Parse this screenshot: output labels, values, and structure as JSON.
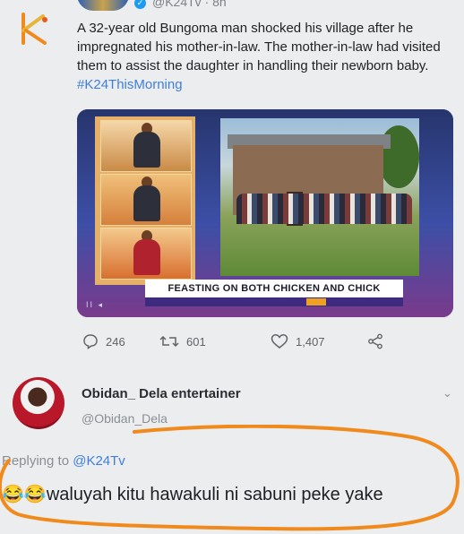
{
  "tweet": {
    "handle_line": "@K24Tv · 8h",
    "verified_mark": "✓",
    "text": "A 32-year old Bungoma man shocked his village after he impregnated his mother-in-law. The mother-in-law had visited them to assist the daughter in handling their newborn baby.",
    "hashtag": "#K24ThisMorning",
    "logo_icon": "k24-logo-icon"
  },
  "media": {
    "banner": "FEASTING ON BOTH CHICKEN AND CHICK",
    "controls": "II ◂"
  },
  "actions": {
    "replies": "246",
    "retweets": "601",
    "likes": "1,407"
  },
  "reply": {
    "name": "Obidan_ Dela entertainer",
    "handle": "@Obidan_Dela",
    "replying_prefix": "Replying to",
    "replying_handle": "@K24Tv",
    "emoji": "😂😂",
    "text": "waluyah kitu hawakuli ni sabuni peke yake",
    "menu_icon": "⌄"
  },
  "colors": {
    "link": "#3d7ee0",
    "annotation_circle": "#f08a1c",
    "background": "#ecedef"
  }
}
